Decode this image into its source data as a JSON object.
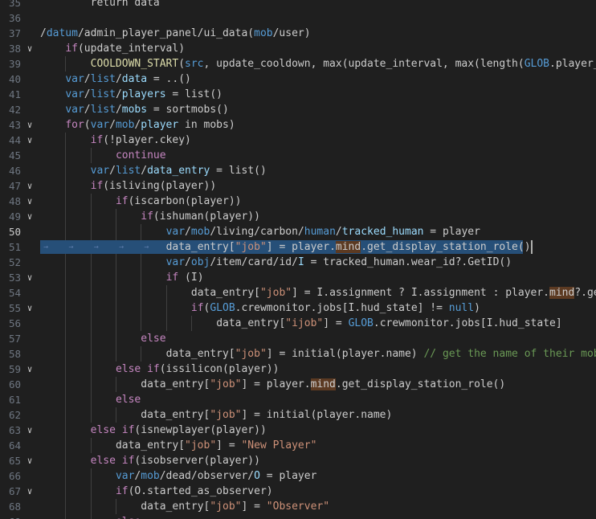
{
  "editor": {
    "active_line": 50,
    "lines": [
      {
        "n": 35,
        "indent": 1,
        "fold": false,
        "tokens": [
          {
            "t": "    return data",
            "c": "p"
          }
        ]
      },
      {
        "n": 36,
        "indent": 0,
        "fold": false,
        "tokens": []
      },
      {
        "n": 37,
        "indent": 0,
        "fold": false,
        "tokens": [
          {
            "t": "/",
            "c": "p"
          },
          {
            "t": "datum",
            "c": "t"
          },
          {
            "t": "/admin_player_panel/ui_data(",
            "c": "p"
          },
          {
            "t": "mob",
            "c": "t"
          },
          {
            "t": "/user)",
            "c": "p"
          }
        ]
      },
      {
        "n": 38,
        "indent": 1,
        "fold": true,
        "tokens": [
          {
            "t": "if",
            "c": "k"
          },
          {
            "t": "(update_interval)",
            "c": "p"
          }
        ]
      },
      {
        "n": 39,
        "indent": 2,
        "fold": false,
        "tokens": [
          {
            "t": "COOLDOWN_START",
            "c": "f"
          },
          {
            "t": "(",
            "c": "p"
          },
          {
            "t": "src",
            "c": "t"
          },
          {
            "t": ", update_cooldown, max(update_interval, max(length(",
            "c": "p"
          },
          {
            "t": "GLOB",
            "c": "t"
          },
          {
            "t": ".player_l",
            "c": "p"
          }
        ]
      },
      {
        "n": 40,
        "indent": 1,
        "fold": false,
        "tokens": [
          {
            "t": "var",
            "c": "t"
          },
          {
            "t": "/",
            "c": "p"
          },
          {
            "t": "list",
            "c": "t"
          },
          {
            "t": "/",
            "c": "p"
          },
          {
            "t": "data",
            "c": "v"
          },
          {
            "t": " = ..()",
            "c": "p"
          }
        ]
      },
      {
        "n": 41,
        "indent": 1,
        "fold": false,
        "tokens": [
          {
            "t": "var",
            "c": "t"
          },
          {
            "t": "/",
            "c": "p"
          },
          {
            "t": "list",
            "c": "t"
          },
          {
            "t": "/",
            "c": "p"
          },
          {
            "t": "players",
            "c": "v"
          },
          {
            "t": " = list()",
            "c": "p"
          }
        ]
      },
      {
        "n": 42,
        "indent": 1,
        "fold": false,
        "tokens": [
          {
            "t": "var",
            "c": "t"
          },
          {
            "t": "/",
            "c": "p"
          },
          {
            "t": "list",
            "c": "t"
          },
          {
            "t": "/",
            "c": "p"
          },
          {
            "t": "mobs",
            "c": "v"
          },
          {
            "t": " = sortmobs()",
            "c": "p"
          }
        ]
      },
      {
        "n": 43,
        "indent": 1,
        "fold": true,
        "tokens": [
          {
            "t": "for",
            "c": "k"
          },
          {
            "t": "(",
            "c": "p"
          },
          {
            "t": "var",
            "c": "t"
          },
          {
            "t": "/",
            "c": "p"
          },
          {
            "t": "mob",
            "c": "t"
          },
          {
            "t": "/",
            "c": "p"
          },
          {
            "t": "player",
            "c": "v"
          },
          {
            "t": " in mobs)",
            "c": "p"
          }
        ]
      },
      {
        "n": 44,
        "indent": 2,
        "fold": true,
        "tokens": [
          {
            "t": "if",
            "c": "k"
          },
          {
            "t": "(!player.ckey)",
            "c": "p"
          }
        ]
      },
      {
        "n": 45,
        "indent": 3,
        "fold": false,
        "tokens": [
          {
            "t": "continue",
            "c": "k"
          }
        ]
      },
      {
        "n": 46,
        "indent": 2,
        "fold": false,
        "tokens": [
          {
            "t": "var",
            "c": "t"
          },
          {
            "t": "/",
            "c": "p"
          },
          {
            "t": "list",
            "c": "t"
          },
          {
            "t": "/",
            "c": "p"
          },
          {
            "t": "data_entry",
            "c": "v"
          },
          {
            "t": " = list()",
            "c": "p"
          }
        ]
      },
      {
        "n": 47,
        "indent": 2,
        "fold": true,
        "tokens": [
          {
            "t": "if",
            "c": "k"
          },
          {
            "t": "(isliving(player))",
            "c": "p"
          }
        ]
      },
      {
        "n": 48,
        "indent": 3,
        "fold": true,
        "tokens": [
          {
            "t": "if",
            "c": "k"
          },
          {
            "t": "(iscarbon(player))",
            "c": "p"
          }
        ]
      },
      {
        "n": 49,
        "indent": 4,
        "fold": true,
        "tokens": [
          {
            "t": "if",
            "c": "k"
          },
          {
            "t": "(ishuman(player))",
            "c": "p"
          }
        ]
      },
      {
        "n": 50,
        "indent": 5,
        "fold": false,
        "tokens": [
          {
            "t": "var",
            "c": "t"
          },
          {
            "t": "/",
            "c": "p"
          },
          {
            "t": "mob",
            "c": "t"
          },
          {
            "t": "/living/carbon/",
            "c": "p"
          },
          {
            "t": "human",
            "c": "t"
          },
          {
            "t": "/",
            "c": "p"
          },
          {
            "t": "tracked_human",
            "c": "v"
          },
          {
            "t": " = player",
            "c": "p"
          }
        ]
      },
      {
        "n": 51,
        "indent": 5,
        "fold": false,
        "selected": true,
        "tokens": [
          {
            "t": "data_entry[",
            "c": "p"
          },
          {
            "t": "\"job\"",
            "c": "s"
          },
          {
            "t": "] = player.",
            "c": "p"
          },
          {
            "t": "mind",
            "c": "p",
            "hl": true
          },
          {
            "t": ".get_display_station_role()",
            "c": "p"
          }
        ]
      },
      {
        "n": 52,
        "indent": 5,
        "fold": false,
        "tokens": [
          {
            "t": "var",
            "c": "t"
          },
          {
            "t": "/",
            "c": "p"
          },
          {
            "t": "obj",
            "c": "t"
          },
          {
            "t": "/item/card/id/",
            "c": "p"
          },
          {
            "t": "I",
            "c": "v"
          },
          {
            "t": " = tracked_human.wear_id?.GetID()",
            "c": "p"
          }
        ]
      },
      {
        "n": 53,
        "indent": 5,
        "fold": true,
        "tokens": [
          {
            "t": "if",
            "c": "k"
          },
          {
            "t": " (I)",
            "c": "p"
          }
        ]
      },
      {
        "n": 54,
        "indent": 6,
        "fold": false,
        "tokens": [
          {
            "t": "data_entry[",
            "c": "p"
          },
          {
            "t": "\"job\"",
            "c": "s"
          },
          {
            "t": "] = I.assignment ? I.assignment : player.",
            "c": "p"
          },
          {
            "t": "mind",
            "c": "p",
            "hl": true
          },
          {
            "t": "?.get",
            "c": "p"
          }
        ]
      },
      {
        "n": 55,
        "indent": 6,
        "fold": true,
        "tokens": [
          {
            "t": "if",
            "c": "k"
          },
          {
            "t": "(",
            "c": "p"
          },
          {
            "t": "GLOB",
            "c": "t"
          },
          {
            "t": ".crewmonitor.jobs[I.hud_state] != ",
            "c": "p"
          },
          {
            "t": "null",
            "c": "t"
          },
          {
            "t": ")",
            "c": "p"
          }
        ]
      },
      {
        "n": 56,
        "indent": 7,
        "fold": false,
        "tokens": [
          {
            "t": "data_entry[",
            "c": "p"
          },
          {
            "t": "\"ijob\"",
            "c": "s"
          },
          {
            "t": "] = ",
            "c": "p"
          },
          {
            "t": "GLOB",
            "c": "t"
          },
          {
            "t": ".crewmonitor.jobs[I.hud_state]",
            "c": "p"
          }
        ]
      },
      {
        "n": 57,
        "indent": 4,
        "fold": false,
        "tokens": [
          {
            "t": "else",
            "c": "k"
          }
        ]
      },
      {
        "n": 58,
        "indent": 5,
        "fold": false,
        "tokens": [
          {
            "t": "data_entry[",
            "c": "p"
          },
          {
            "t": "\"job\"",
            "c": "s"
          },
          {
            "t": "] = initial(player.name) ",
            "c": "p"
          },
          {
            "t": "// get the name of their mob",
            "c": "c"
          }
        ]
      },
      {
        "n": 59,
        "indent": 3,
        "fold": true,
        "tokens": [
          {
            "t": "else if",
            "c": "k"
          },
          {
            "t": "(issilicon(player))",
            "c": "p"
          }
        ]
      },
      {
        "n": 60,
        "indent": 4,
        "fold": false,
        "tokens": [
          {
            "t": "data_entry[",
            "c": "p"
          },
          {
            "t": "\"job\"",
            "c": "s"
          },
          {
            "t": "] = player.",
            "c": "p"
          },
          {
            "t": "mind",
            "c": "p",
            "hl": true
          },
          {
            "t": ".get_display_station_role()",
            "c": "p"
          }
        ]
      },
      {
        "n": 61,
        "indent": 3,
        "fold": false,
        "tokens": [
          {
            "t": "else",
            "c": "k"
          }
        ]
      },
      {
        "n": 62,
        "indent": 4,
        "fold": false,
        "tokens": [
          {
            "t": "data_entry[",
            "c": "p"
          },
          {
            "t": "\"job\"",
            "c": "s"
          },
          {
            "t": "] = initial(player.name)",
            "c": "p"
          }
        ]
      },
      {
        "n": 63,
        "indent": 2,
        "fold": true,
        "tokens": [
          {
            "t": "else if",
            "c": "k"
          },
          {
            "t": "(isnewplayer(player))",
            "c": "p"
          }
        ]
      },
      {
        "n": 64,
        "indent": 3,
        "fold": false,
        "tokens": [
          {
            "t": "data_entry[",
            "c": "p"
          },
          {
            "t": "\"job\"",
            "c": "s"
          },
          {
            "t": "] = ",
            "c": "p"
          },
          {
            "t": "\"New Player\"",
            "c": "s"
          }
        ]
      },
      {
        "n": 65,
        "indent": 2,
        "fold": true,
        "tokens": [
          {
            "t": "else if",
            "c": "k"
          },
          {
            "t": "(isobserver(player))",
            "c": "p"
          }
        ]
      },
      {
        "n": 66,
        "indent": 3,
        "fold": false,
        "tokens": [
          {
            "t": "var",
            "c": "t"
          },
          {
            "t": "/",
            "c": "p"
          },
          {
            "t": "mob",
            "c": "t"
          },
          {
            "t": "/dead/observer/",
            "c": "p"
          },
          {
            "t": "O",
            "c": "v"
          },
          {
            "t": " = player",
            "c": "p"
          }
        ]
      },
      {
        "n": 67,
        "indent": 3,
        "fold": true,
        "tokens": [
          {
            "t": "if",
            "c": "k"
          },
          {
            "t": "(O.started_as_observer)",
            "c": "p"
          }
        ]
      },
      {
        "n": 68,
        "indent": 4,
        "fold": false,
        "tokens": [
          {
            "t": "data_entry[",
            "c": "p"
          },
          {
            "t": "\"job\"",
            "c": "s"
          },
          {
            "t": "] = ",
            "c": "p"
          },
          {
            "t": "\"Observer\"",
            "c": "s"
          }
        ]
      },
      {
        "n": 69,
        "indent": 3,
        "fold": false,
        "tokens": [
          {
            "t": "else",
            "c": "k"
          }
        ]
      }
    ]
  }
}
